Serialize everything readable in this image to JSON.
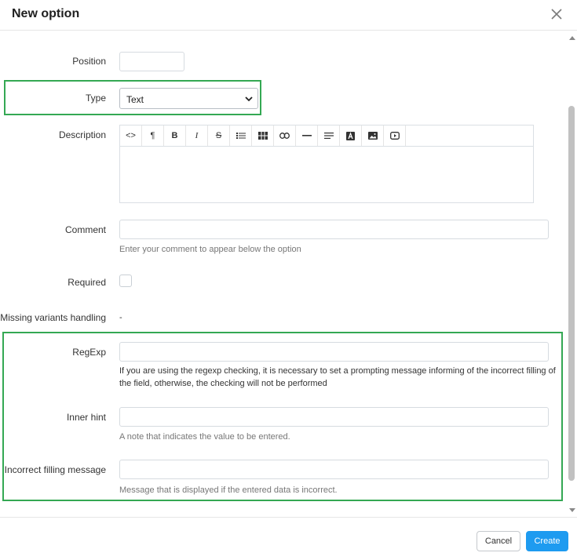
{
  "dialog": {
    "title": "New option"
  },
  "form": {
    "position": {
      "label": "Position",
      "value": ""
    },
    "type": {
      "label": "Type",
      "selected": "Text"
    },
    "description": {
      "label": "Description",
      "toolbar": [
        "<>",
        "¶",
        "B",
        "I",
        "S",
        "list",
        "table",
        "link",
        "hr",
        "align",
        "text-color",
        "image",
        "video"
      ]
    },
    "comment": {
      "label": "Comment",
      "value": "",
      "hint": "Enter your comment to appear below the option"
    },
    "required": {
      "label": "Required",
      "checked": false
    },
    "missing_variants": {
      "label": "Missing variants handling",
      "value": "-"
    },
    "regexp": {
      "label": "RegExp",
      "value": "",
      "note": "If you are using the regexp checking, it is necessary to set a prompting message informing of the incorrect filling of the field, otherwise, the checking will not be performed"
    },
    "inner_hint": {
      "label": "Inner hint",
      "value": "",
      "hint": "A note that indicates the value to be entered."
    },
    "incorrect_message": {
      "label": "Incorrect filling message",
      "value": "",
      "hint": "Message that is displayed if the entered data is incorrect."
    }
  },
  "footer": {
    "cancel_label": "Cancel",
    "create_label": "Create"
  },
  "colors": {
    "highlight": "#34a853",
    "primary": "#1e9bf0"
  }
}
